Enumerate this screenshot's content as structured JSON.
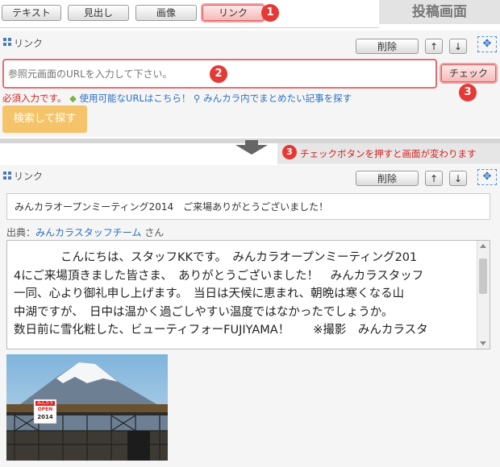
{
  "toolbar": {
    "tabs": [
      "テキスト",
      "見出し",
      "画像",
      "リンク"
    ],
    "post_screen_label": "投稿画面"
  },
  "link_form": {
    "title": "リンク",
    "delete_label": "削除",
    "up_label": "↑",
    "down_label": "↓",
    "url_placeholder": "参照元画面のURLを入力して下さい。",
    "check_label": "チェック",
    "required": "必須入力です。",
    "available_url_link": "使用可能なURLはこちら！",
    "search_hint": "みんカラ内でまとめたい記事を探す",
    "search_button": "検索して探す"
  },
  "badges": {
    "b1": "1",
    "b2": "2",
    "b3": "3",
    "b3b": "3"
  },
  "divider_note": "チェックボタンを押すと画面が変わります",
  "result": {
    "title": "リンク",
    "delete_label": "削除",
    "up_label": "↑",
    "down_label": "↓",
    "article_title": "みんカラオープンミーティング2014　ご来場ありがとうございました！",
    "source_label": "出典：",
    "source_name": "みんカラスタッフチーム",
    "source_suffix": " さん",
    "body_lines": [
      "　　　　こんにちは、スタッフKKです。　みんカラオープンミーティング201",
      "4にご来場頂きました皆さま、　ありがとうございました！　みんカラスタッフ",
      "一同、心より御礼申し上げます。　当日は天候に恵まれ、朝晩は寒くなる山",
      "中湖ですが、　日中は温かく過ごしやすい温度ではなかったでしょうか。",
      "数日前に雪化粧した、ビューティフォーFUJIYAMA！　　※撮影　みんカラスタ"
    ],
    "photo_sign_top": "みんカラ",
    "photo_sign_mid": "OPEN",
    "photo_sign_bottom": "2014"
  },
  "colors": {
    "accent_red": "#e53935",
    "link_blue": "#2a6fc1",
    "search_button": "#f5c46a"
  }
}
